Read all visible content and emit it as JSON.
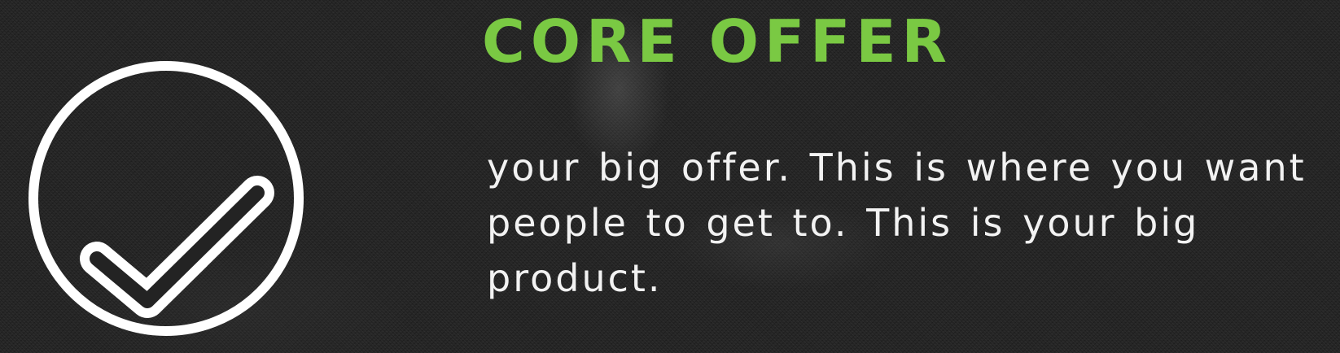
{
  "section": {
    "title": "CORE OFFER",
    "description": "your big offer.  This is where you want people to get to.  This is your big product.",
    "icon": "checkmark-circle-icon"
  },
  "colors": {
    "title": "#7ac943",
    "text": "#f2f2f2",
    "icon": "#ffffff",
    "background": "#232323"
  }
}
